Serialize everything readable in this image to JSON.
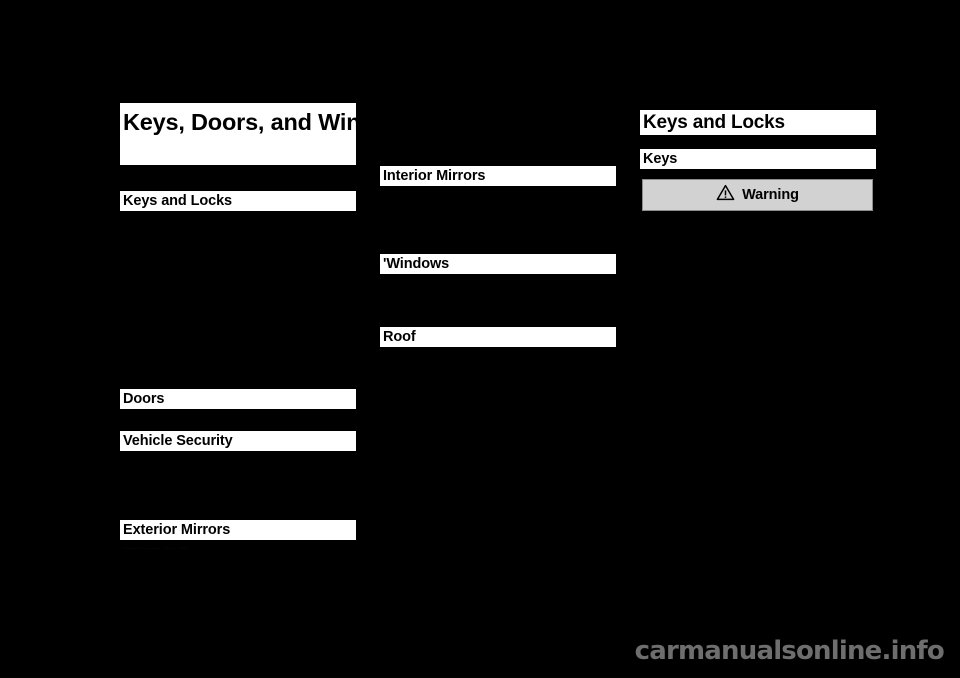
{
  "document": {
    "background_color": "#000000",
    "bar_color": "#ffffff",
    "warning_fill": "#d2d2d2",
    "warning_border": "#8c8c8c",
    "watermark_color": "#6e6e6e"
  },
  "left_column": {
    "chapter_title": "Keys, Doors, and Windows",
    "headings": [
      {
        "label": "Keys and Locks"
      },
      {
        "label": "Doors"
      },
      {
        "label": "Vehicle Security"
      },
      {
        "label": "Exterior Mirrors"
      }
    ],
    "faint_text": "............. .... ..."
  },
  "middle_column": {
    "headings": [
      {
        "label": "Interior Mirrors"
      },
      {
        "label": "'Windows"
      },
      {
        "label": "Roof"
      }
    ]
  },
  "right_column": {
    "section_title": "Keys and Locks",
    "subsection_title": "Keys",
    "warning": {
      "label": "Warning",
      "icon": "warning-triangle-icon"
    }
  },
  "watermark": {
    "text": "carmanualsonline.info"
  }
}
